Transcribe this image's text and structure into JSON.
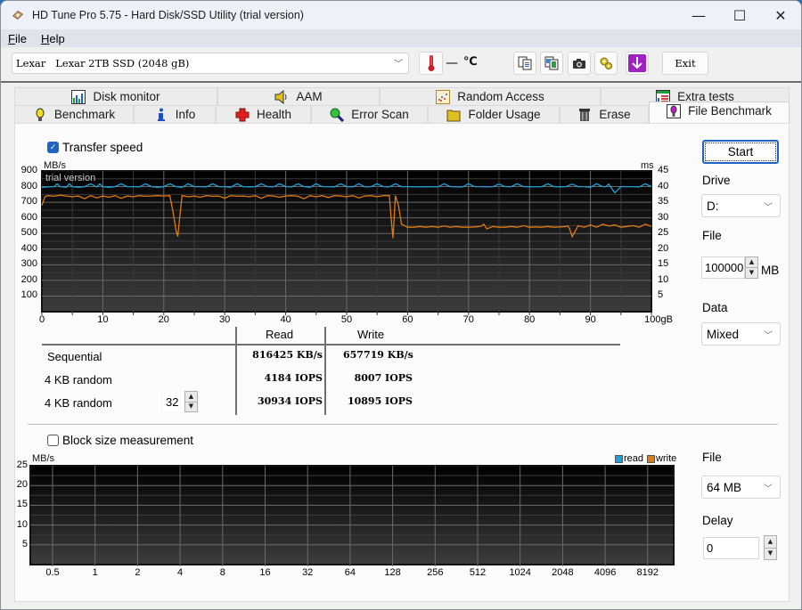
{
  "window": {
    "title": "HD Tune Pro 5.75 - Hard Disk/SSD Utility (trial version)",
    "controls": {
      "minimize": "—",
      "maximize": "☐",
      "close": "✕"
    }
  },
  "menu": [
    "File",
    "Help"
  ],
  "toolbar": {
    "drive": "Lexar   Lexar 2TB SSD (2048 gB)",
    "temperature_value": "—",
    "temperature_unit": "℃",
    "exit_label": "Exit",
    "buttons": [
      "copy-info",
      "copy-screenshot",
      "save-screenshot",
      "options",
      "save-download"
    ]
  },
  "tabs": {
    "row1": [
      {
        "label": "Disk monitor",
        "icon": "disk-monitor-icon"
      },
      {
        "label": "AAM",
        "icon": "speaker-icon"
      },
      {
        "label": "Random Access",
        "icon": "random-access-icon"
      },
      {
        "label": "Extra tests",
        "icon": "extra-tests-icon"
      }
    ],
    "row2": [
      {
        "label": "Benchmark",
        "icon": "lightbulb-icon"
      },
      {
        "label": "Info",
        "icon": "info-icon"
      },
      {
        "label": "Health",
        "icon": "health-cross-icon"
      },
      {
        "label": "Error Scan",
        "icon": "magnifier-icon"
      },
      {
        "label": "Folder Usage",
        "icon": "folder-icon"
      },
      {
        "label": "Erase",
        "icon": "trash-icon"
      },
      {
        "label": "File Benchmark",
        "icon": "file-benchmark-icon",
        "active": true
      }
    ]
  },
  "transfer": {
    "checkbox_label": "Transfer speed",
    "checked": true,
    "watermark": "trial version"
  },
  "results": {
    "headers": {
      "read": "Read",
      "write": "Write"
    },
    "rows": [
      {
        "label": "Sequential",
        "read": "816425 KB/s",
        "write": "657719 KB/s"
      },
      {
        "label": "4 KB random",
        "read": "4184 IOPS",
        "write": "8007 IOPS"
      },
      {
        "label": "4 KB random",
        "read": "30934 IOPS",
        "write": "10895 IOPS",
        "queue_depth": "32"
      }
    ]
  },
  "side": {
    "start_label": "Start",
    "drive_label": "Drive",
    "drive_value": "D:",
    "file_label": "File",
    "file_value": "100000",
    "file_unit": "MB",
    "data_label": "Data",
    "data_value": "Mixed"
  },
  "block": {
    "checkbox_label": "Block size measurement",
    "checked": false,
    "file_label": "File",
    "file_value": "64 MB",
    "delay_label": "Delay",
    "delay_value": "0",
    "legend": {
      "read": "read",
      "write": "write"
    }
  },
  "colors": {
    "read": "#1ea0d8",
    "write": "#e07a10",
    "accent": "#1f63c3"
  },
  "chart_data": [
    {
      "type": "line",
      "title": "Transfer speed",
      "xlabel": "gB",
      "ylabel": "MB/s",
      "ylabel_right": "ms",
      "xlim": [
        0,
        100
      ],
      "ylim": [
        0,
        900
      ],
      "ylim_right": [
        0,
        45
      ],
      "x_ticks": [
        "0",
        "10",
        "20",
        "30",
        "40",
        "50",
        "60",
        "70",
        "80",
        "90",
        "100gB"
      ],
      "y_ticks": [
        "900",
        "800",
        "700",
        "600",
        "500",
        "400",
        "300",
        "200",
        "100"
      ],
      "y_ticks_right": [
        "45",
        "40",
        "35",
        "30",
        "25",
        "20",
        "15",
        "10",
        "5"
      ],
      "grid": true,
      "series": [
        {
          "name": "read",
          "x": [
            0,
            1,
            2,
            2.5,
            3,
            4,
            4.5,
            5,
            6,
            7,
            8,
            9,
            9.5,
            10,
            11,
            12,
            13,
            14,
            15,
            16,
            17,
            18,
            19,
            20,
            21,
            22,
            23,
            24,
            25,
            26,
            27,
            28,
            29,
            30,
            31,
            32,
            33,
            34,
            35,
            36,
            37,
            38,
            39,
            40,
            41,
            42,
            43,
            44,
            45,
            46,
            47,
            48,
            49,
            50,
            51,
            52,
            53,
            54,
            55,
            56,
            57,
            58,
            59,
            60,
            61,
            62,
            63,
            64,
            65,
            66,
            67,
            68,
            69,
            70,
            71,
            72,
            73,
            74,
            75,
            76,
            77,
            78,
            79,
            80,
            81,
            82,
            83,
            84,
            85,
            86,
            87,
            88,
            89,
            90,
            91,
            92,
            92.5,
            93,
            94,
            95,
            96,
            97,
            98,
            99,
            100
          ],
          "y": [
            795,
            798,
            800,
            818,
            800,
            796,
            818,
            800,
            796,
            800,
            818,
            798,
            818,
            800,
            796,
            800,
            818,
            800,
            800,
            798,
            818,
            800,
            796,
            800,
            818,
            800,
            796,
            818,
            800,
            800,
            798,
            818,
            800,
            800,
            796,
            818,
            800,
            798,
            800,
            818,
            800,
            798,
            818,
            800,
            798,
            818,
            800,
            796,
            818,
            800,
            800,
            798,
            818,
            800,
            798,
            818,
            798,
            800,
            818,
            800,
            798,
            818,
            800,
            800,
            798,
            800,
            798,
            800,
            798,
            818,
            800,
            798,
            798,
            818,
            800,
            800,
            798,
            800,
            816,
            800,
            800,
            818,
            800,
            798,
            800,
            800,
            818,
            800,
            798,
            800,
            816,
            800,
            800,
            796,
            818,
            800,
            800,
            816,
            760,
            800,
            800,
            800,
            798,
            818,
            800,
            800,
            800
          ]
        },
        {
          "name": "write",
          "x": [
            0,
            0.5,
            1,
            2,
            3,
            4,
            5,
            6,
            7,
            8,
            9,
            10,
            11,
            12,
            13,
            14,
            15,
            16,
            17,
            18,
            19,
            20,
            21,
            21.5,
            22,
            22.3,
            22.6,
            23,
            24,
            25,
            26,
            27,
            28,
            29,
            30,
            31,
            32,
            33,
            34,
            35,
            36,
            37,
            38,
            39,
            40,
            41,
            42,
            43,
            44,
            45,
            46,
            47,
            48,
            49,
            50,
            51,
            52,
            53,
            54,
            55,
            56,
            57,
            57.3,
            57.6,
            58,
            58.5,
            59,
            60,
            61,
            62,
            63,
            64,
            65,
            66,
            67,
            68,
            69,
            70,
            71,
            72,
            72.5,
            73,
            74,
            75,
            76,
            77,
            78,
            79,
            80,
            81,
            82,
            83,
            84,
            85,
            86,
            86.3,
            86.6,
            87,
            88,
            89,
            90,
            91,
            92,
            93,
            94,
            95,
            96,
            97,
            98,
            99,
            100
          ],
          "y": [
            680,
            735,
            742,
            738,
            745,
            740,
            735,
            740,
            722,
            742,
            728,
            740,
            732,
            742,
            725,
            740,
            735,
            742,
            738,
            740,
            742,
            740,
            742,
            640,
            520,
            480,
            600,
            742,
            735,
            740,
            732,
            742,
            738,
            740,
            726,
            742,
            738,
            740,
            735,
            742,
            725,
            742,
            740,
            732,
            740,
            742,
            738,
            722,
            742,
            735,
            742,
            730,
            742,
            740,
            735,
            742,
            728,
            740,
            742,
            735,
            742,
            742,
            600,
            470,
            742,
            680,
            560,
            540,
            540,
            545,
            540,
            545,
            540,
            548,
            540,
            545,
            540,
            540,
            542,
            545,
            560,
            530,
            545,
            540,
            540,
            545,
            540,
            550,
            540,
            542,
            540,
            545,
            540,
            542,
            545,
            548,
            530,
            480,
            550,
            540,
            555,
            540,
            560,
            548,
            555,
            540,
            545,
            550,
            540,
            560,
            545,
            540,
            550
          ]
        }
      ]
    },
    {
      "type": "bar",
      "title": "Block size measurement",
      "xlabel": "",
      "ylabel": "MB/s",
      "ylim": [
        0,
        25
      ],
      "y_ticks": [
        "25",
        "20",
        "15",
        "10",
        "5"
      ],
      "categories": [
        "0.5",
        "1",
        "2",
        "4",
        "8",
        "16",
        "32",
        "64",
        "128",
        "256",
        "512",
        "1024",
        "2048",
        "4096",
        "8192"
      ],
      "series": [
        {
          "name": "read",
          "values": []
        },
        {
          "name": "write",
          "values": []
        }
      ],
      "grid": true,
      "legend": "top-right"
    }
  ]
}
